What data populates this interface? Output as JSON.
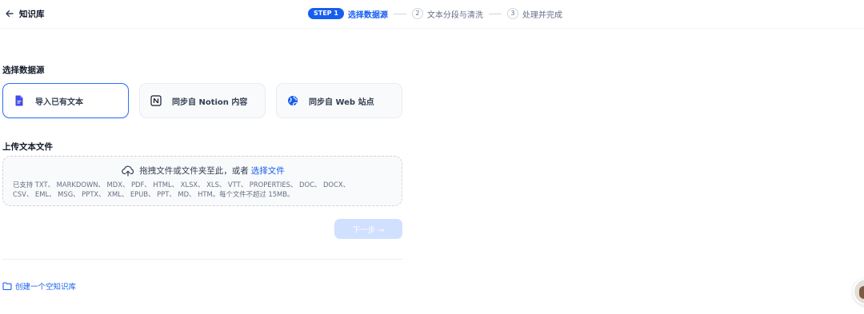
{
  "header": {
    "back_icon": "arrow-left-icon",
    "title": "知识库"
  },
  "steps": {
    "active_badge": "STEP 1",
    "active_label": "选择数据源",
    "step2_num": "2",
    "step2_label": "文本分段与清洗",
    "step3_num": "3",
    "step3_label": "处理并完成",
    "accent": "#155eef"
  },
  "data_source": {
    "title": "选择数据源",
    "options": [
      {
        "label": "导入已有文本",
        "icon": "file-text-icon",
        "selected": true
      },
      {
        "label": "同步自 Notion 内容",
        "icon": "notion-icon",
        "selected": false
      },
      {
        "label": "同步自 Web 站点",
        "icon": "globe-icon",
        "selected": false
      }
    ]
  },
  "upload": {
    "title": "上传文本文件",
    "prompt": "拖拽文件或文件夹至此，或者",
    "link": "选择文件",
    "supported_line1": "已支持 TXT、 MARKDOWN、 MDX、 PDF、 HTML、 XLSX、 XLS、 VTT、 PROPERTIES、 DOC、 DOCX、",
    "supported_line2": "CSV、 EML、 MSG、 PPTX、 XML、 EPUB、 PPT、 MD、 HTM。每个文件不超过 15MB。"
  },
  "next_button": {
    "label": "下一步 →",
    "disabled": true
  },
  "create_empty": {
    "label": "创建一个空知识库",
    "icon": "folder-icon"
  }
}
